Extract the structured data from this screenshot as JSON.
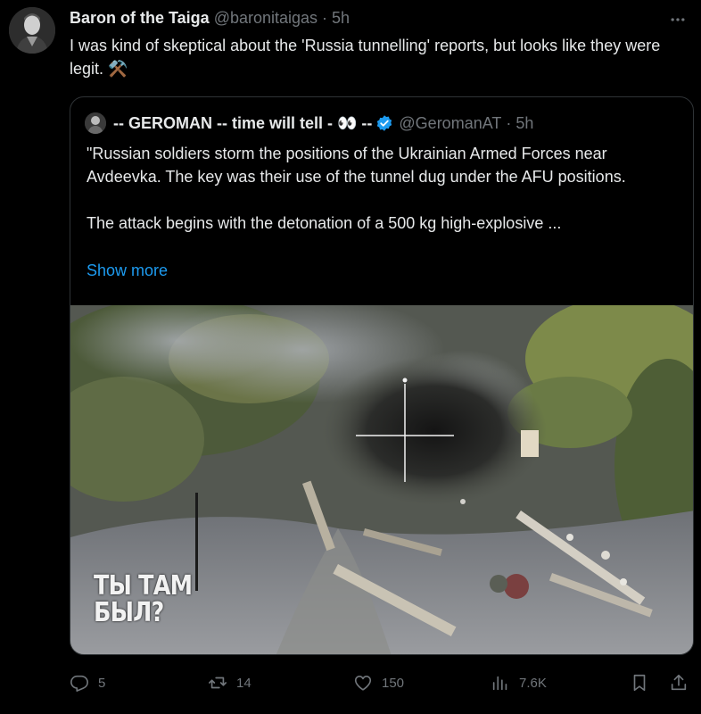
{
  "tweet": {
    "author_name": "Baron of the Taiga",
    "author_handle": "@baronitaigas",
    "separator": "·",
    "time": "5h",
    "text": "I was kind of skeptical about the 'Russia tunnelling' reports, but looks like they were legit. ⚒️"
  },
  "quote": {
    "name": "-- GEROMAN -- time will tell - 👀 --",
    "handle": "@GeromanAT",
    "separator": "·",
    "time": "5h",
    "text": "\"Russian soldiers storm the positions of the Ukrainian Armed Forces near Avdeevka.  The key was their use of the tunnel dug under the AFU positions.\n\n The attack begins with the detonation of a 500 kg high-explosive ...",
    "show_more": "Show more",
    "media_watermark_line1": "ТЫ ТАМ",
    "media_watermark_line2": "БЫЛ?"
  },
  "actions": {
    "replies": "5",
    "reposts": "14",
    "likes": "150",
    "views": "7.6K"
  },
  "icons": {
    "more": "more-icon",
    "verified": "verified-badge-icon",
    "reply": "reply-icon",
    "repost": "repost-icon",
    "like": "heart-icon",
    "views": "views-icon",
    "bookmark": "bookmark-icon",
    "share": "share-icon"
  },
  "colors": {
    "background": "#000000",
    "text_primary": "#e7e9ea",
    "text_secondary": "#71767b",
    "link": "#1d9bf0",
    "border": "#2f3336",
    "verified": "#1d9bf0"
  }
}
